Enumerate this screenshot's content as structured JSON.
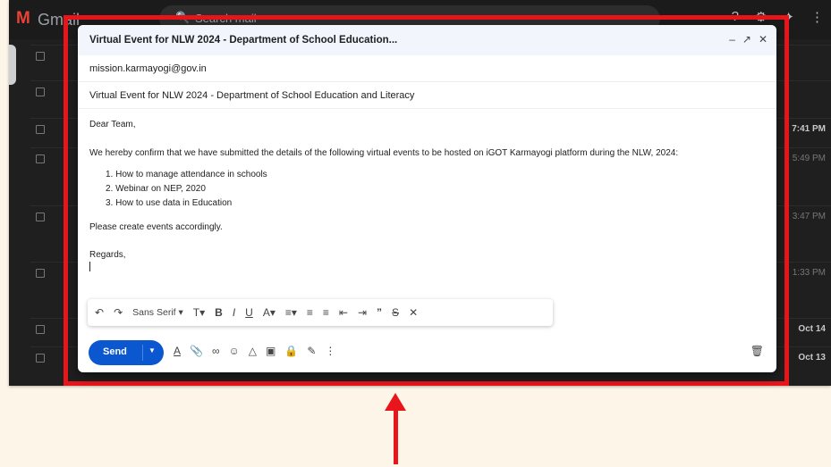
{
  "gmail": {
    "logo_glyph": "M",
    "logo_text": "Gmail",
    "search_placeholder": "Search mail",
    "dates": [
      "7:41 PM",
      "5:49 PM",
      "3:47 PM",
      "1:33 PM",
      "Oct 14",
      "Oct 13"
    ]
  },
  "compose": {
    "window_title": "Virtual Event for NLW 2024 - Department of School Education...",
    "to": "mission.karmayogi@gov.in",
    "subject": "Virtual Event for NLW 2024 - Department of School Education and Literacy",
    "greeting": "Dear Team,",
    "intro": "We hereby confirm that we have submitted the details of the following virtual events to be hosted on iGOT Karmayogi platform during the NLW, 2024:",
    "events": [
      "1. How to manage attendance in schools",
      "2. Webinar on NEP, 2020",
      "3. How to use data in Education"
    ],
    "request": "Please create events accordingly.",
    "signoff": "Regards,"
  },
  "toolbar": {
    "font": "Sans Serif",
    "send_label": "Send"
  },
  "colors": {
    "highlight": "#e8161b",
    "send": "#0b57d0"
  }
}
